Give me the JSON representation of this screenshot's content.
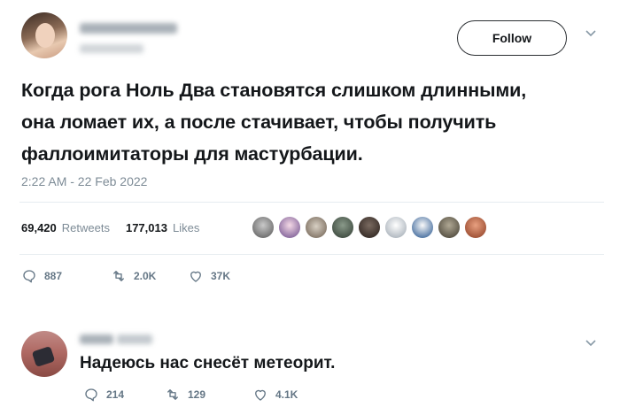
{
  "tweet": {
    "follow_label": "Follow",
    "text_lines": [
      "Когда рога Ноль Два становятся слишком длинными,",
      "она ломает их, а после стачивает, чтобы получить",
      "фаллоимитаторы для мастурбации."
    ],
    "timestamp": "2:22 AM - 22 Feb 2022",
    "retweets_count": "69,420",
    "retweets_label": "Retweets",
    "likes_count": "177,013",
    "likes_label": "Likes",
    "actions": {
      "reply_count": "887",
      "retweet_count": "2.0K",
      "like_count": "37K"
    }
  },
  "reply": {
    "text": "Надеюсь нас снесёт метеорит.",
    "actions": {
      "reply_count": "214",
      "retweet_count": "129",
      "like_count": "4.1K"
    }
  },
  "icons": {
    "chevron": "chevron-down-icon",
    "reply": "reply-icon",
    "retweet": "retweet-icon",
    "like": "heart-icon"
  },
  "colors": {
    "text": "#14171a",
    "muted": "#7d8b96",
    "divider": "#e6ecf0"
  }
}
